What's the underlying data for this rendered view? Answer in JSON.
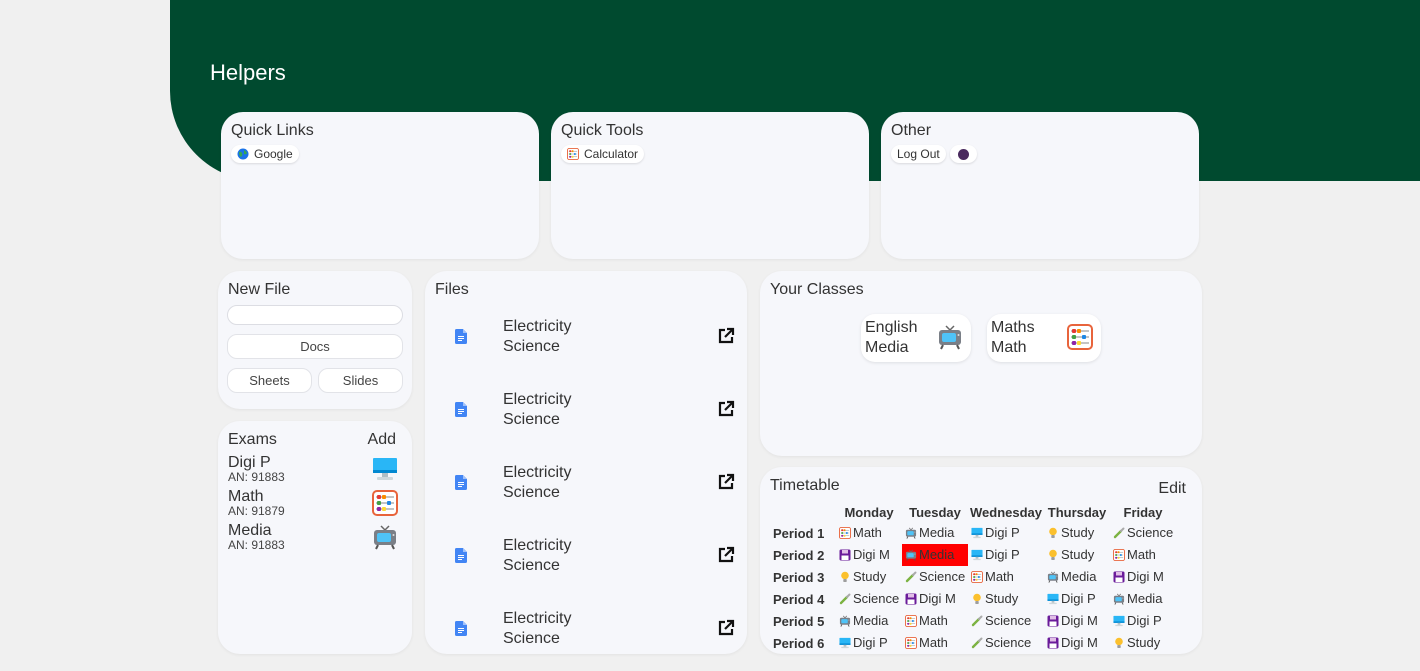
{
  "page": {
    "title": "Helpers"
  },
  "quick_links": {
    "title": "Quick Links",
    "items": [
      {
        "label": "Google",
        "icon": "globe-icon"
      }
    ]
  },
  "quick_tools": {
    "title": "Quick Tools",
    "items": [
      {
        "label": "Calculator",
        "icon": "abacus-icon"
      }
    ]
  },
  "other": {
    "title": "Other",
    "items": [
      {
        "label": "Log Out",
        "icon": ""
      },
      {
        "label": "",
        "icon": "purple-dot-icon"
      }
    ]
  },
  "new_file": {
    "title": "New File",
    "input_value": "",
    "docs_label": "Docs",
    "sheets_label": "Sheets",
    "slides_label": "Slides"
  },
  "exams": {
    "title": "Exams",
    "add_label": "Add",
    "items": [
      {
        "name": "Digi P",
        "an": "AN: 91883",
        "icon": "desktop-computer-icon"
      },
      {
        "name": "Math",
        "an": "AN: 91879",
        "icon": "abacus-icon"
      },
      {
        "name": "Media",
        "an": "AN: 91883",
        "icon": "television-icon"
      }
    ]
  },
  "files": {
    "title": "Files",
    "items": [
      {
        "name": "Electricity",
        "subject": "Science"
      },
      {
        "name": "Electricity",
        "subject": "Science"
      },
      {
        "name": "Electricity",
        "subject": "Science"
      },
      {
        "name": "Electricity",
        "subject": "Science"
      },
      {
        "name": "Electricity",
        "subject": "Science"
      }
    ]
  },
  "classes": {
    "title": "Your Classes",
    "items": [
      {
        "line1": "English",
        "line2": "Media",
        "icon": "television-icon"
      },
      {
        "line1": "Maths",
        "line2": "Math",
        "icon": "abacus-icon"
      }
    ]
  },
  "timetable": {
    "title": "Timetable",
    "edit_label": "Edit",
    "days": [
      "Monday",
      "Tuesday",
      "Wednesday",
      "Thursday",
      "Friday"
    ],
    "highlight_color": "#ff0000",
    "rows": [
      {
        "period": "Period 1",
        "cells": [
          {
            "label": "Math",
            "icon": "abacus-icon"
          },
          {
            "label": "Media",
            "icon": "television-icon"
          },
          {
            "label": "Digi P",
            "icon": "desktop-computer-icon"
          },
          {
            "label": "Study",
            "icon": "lightbulb-icon"
          },
          {
            "label": "Science",
            "icon": "pipette-icon"
          }
        ]
      },
      {
        "period": "Period 2",
        "cells": [
          {
            "label": "Digi M",
            "icon": "floppy-disk-icon"
          },
          {
            "label": "Media",
            "icon": "television-icon",
            "highlight": true
          },
          {
            "label": "Digi P",
            "icon": "desktop-computer-icon"
          },
          {
            "label": "Study",
            "icon": "lightbulb-icon"
          },
          {
            "label": "Math",
            "icon": "abacus-icon"
          }
        ]
      },
      {
        "period": "Period 3",
        "cells": [
          {
            "label": "Study",
            "icon": "lightbulb-icon"
          },
          {
            "label": "Science",
            "icon": "pipette-icon"
          },
          {
            "label": "Math",
            "icon": "abacus-icon"
          },
          {
            "label": "Media",
            "icon": "television-icon"
          },
          {
            "label": "Digi M",
            "icon": "floppy-disk-icon"
          }
        ]
      },
      {
        "period": "Period 4",
        "cells": [
          {
            "label": "Science",
            "icon": "pipette-icon"
          },
          {
            "label": "Digi M",
            "icon": "floppy-disk-icon"
          },
          {
            "label": "Study",
            "icon": "lightbulb-icon"
          },
          {
            "label": "Digi P",
            "icon": "desktop-computer-icon"
          },
          {
            "label": "Media",
            "icon": "television-icon"
          }
        ]
      },
      {
        "period": "Period 5",
        "cells": [
          {
            "label": "Media",
            "icon": "television-icon"
          },
          {
            "label": "Math",
            "icon": "abacus-icon"
          },
          {
            "label": "Science",
            "icon": "pipette-icon"
          },
          {
            "label": "Digi M",
            "icon": "floppy-disk-icon"
          },
          {
            "label": "Digi P",
            "icon": "desktop-computer-icon"
          }
        ]
      },
      {
        "period": "Period 6",
        "cells": [
          {
            "label": "Digi P",
            "icon": "desktop-computer-icon"
          },
          {
            "label": "Math",
            "icon": "abacus-icon"
          },
          {
            "label": "Science",
            "icon": "pipette-icon"
          },
          {
            "label": "Digi M",
            "icon": "floppy-disk-icon"
          },
          {
            "label": "Study",
            "icon": "lightbulb-icon"
          }
        ]
      }
    ]
  },
  "colors": {
    "banner": "#004a2f",
    "card": "#f6f7fb",
    "background": "#f0f0f0",
    "doc_icon": "#4285f4"
  }
}
